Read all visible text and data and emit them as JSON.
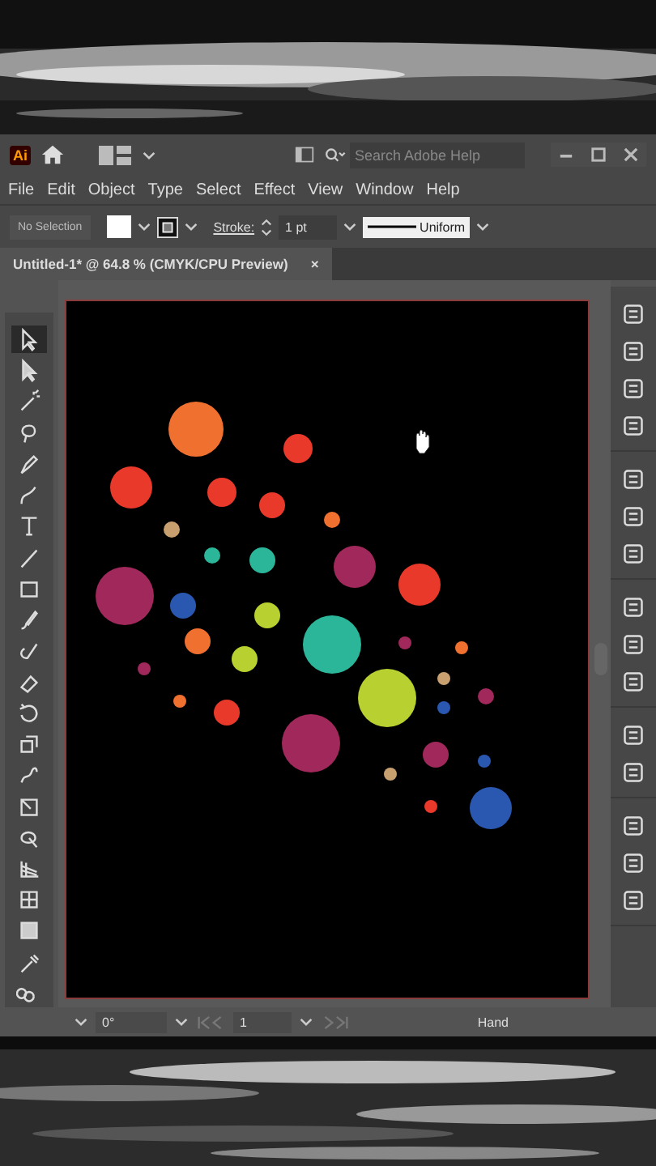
{
  "app_bar": {
    "logo": "Ai",
    "search": {
      "placeholder": "Search Adobe Help"
    }
  },
  "menu": [
    "File",
    "Edit",
    "Object",
    "Type",
    "Select",
    "Effect",
    "View",
    "Window",
    "Help"
  ],
  "control_bar": {
    "selection": "No Selection",
    "stroke_label": "Stroke:",
    "stroke_weight": "1 pt",
    "profile": "Uniform"
  },
  "document_tab": {
    "title": "Untitled-1* @ 64.8 % (CMYK/CPU Preview)",
    "close": "×",
    "selected": true
  },
  "tools": [
    {
      "selected": true
    },
    {
      "selected": false
    },
    {
      "selected": false
    },
    {
      "selected": false
    },
    {
      "selected": false
    },
    {
      "selected": false
    },
    {
      "selected": false
    },
    {
      "selected": false
    },
    {
      "selected": false
    },
    {
      "selected": false
    },
    {
      "selected": false
    },
    {
      "selected": false
    },
    {
      "selected": false
    },
    {
      "selected": false
    },
    {
      "selected": false
    },
    {
      "selected": false
    },
    {
      "selected": false
    },
    {
      "selected": false
    },
    {
      "selected": false
    },
    {
      "selected": false
    },
    {
      "selected": false
    },
    {
      "selected": false
    }
  ],
  "status_bar": {
    "rotation": "0°",
    "artboard": "1",
    "tool": "Hand"
  }
}
